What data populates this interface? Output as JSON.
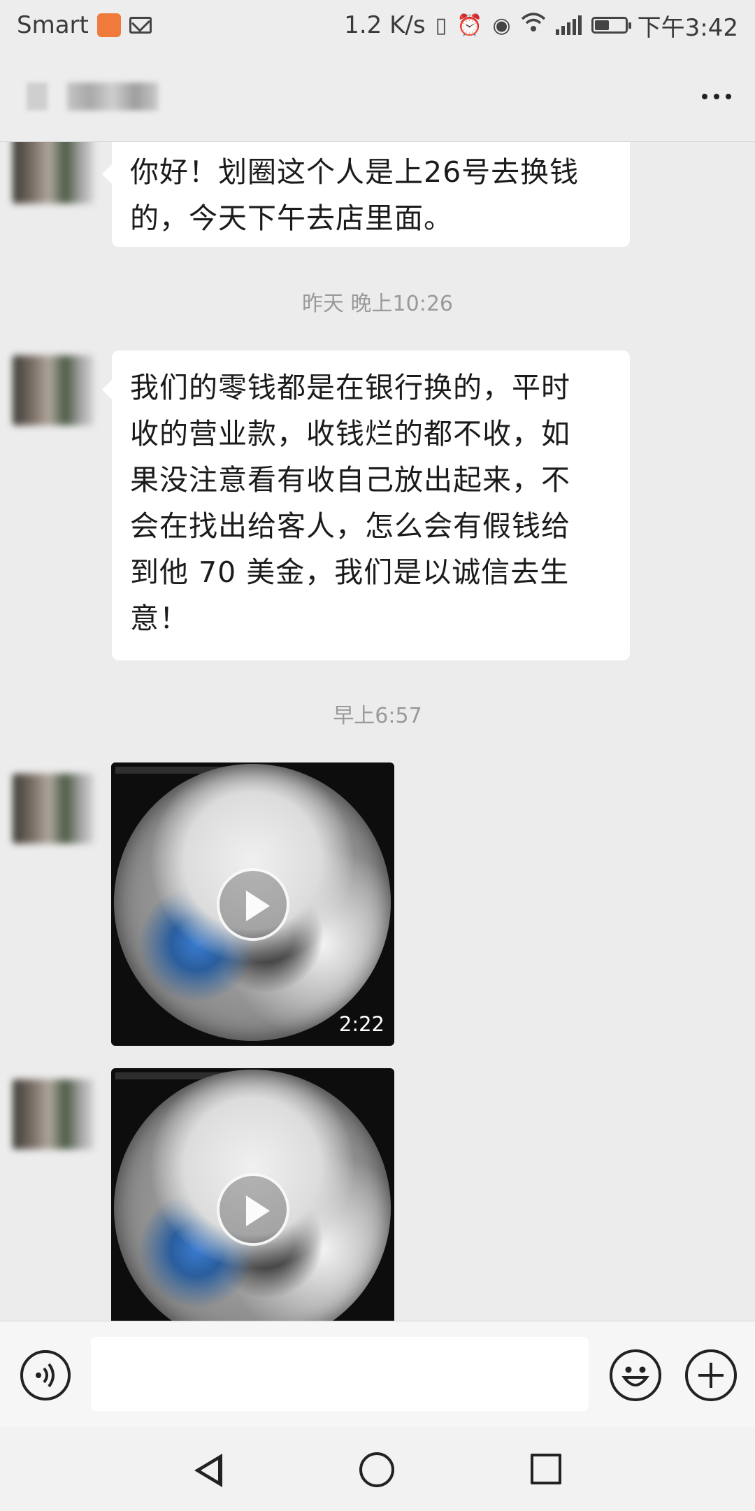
{
  "status_bar": {
    "carrier": "Smart",
    "net_speed": "1.2 K/s",
    "time": "下午3:42",
    "icons": [
      "app-badge-icon",
      "mail-icon",
      "vibrate-icon",
      "alarm-icon",
      "eye-icon",
      "wifi-icon",
      "signal-icon",
      "battery-icon"
    ],
    "battery_level": 0.45
  },
  "header": {
    "more_icon": "more-dots-icon"
  },
  "messages": [
    {
      "type": "text",
      "text_lines": [
        "你好！划圈这个人是上26号去换钱",
        "的，今天下午去店里面。"
      ]
    },
    {
      "type": "timestamp",
      "text": "昨天 晚上10:26"
    },
    {
      "type": "text",
      "text_lines": [
        "我们的零钱都是在银行换的，平时",
        "收的营业款，收钱烂的都不收，如",
        "果没注意看有收自己放出起来，不",
        "会在找出给客人，怎么会有假钱给",
        "到他 70 美金，我们是以诚信去生",
        "意！"
      ]
    },
    {
      "type": "timestamp",
      "text": "早上6:57"
    },
    {
      "type": "video",
      "duration": "2:22"
    },
    {
      "type": "video",
      "duration": ""
    }
  ],
  "input_bar": {
    "voice_icon": "voice-icon",
    "text_value": "",
    "emoji_icon": "emoji-icon",
    "plus_icon": "plus-icon"
  },
  "system_nav": {
    "icons": [
      "back-icon",
      "home-icon",
      "recent-apps-icon"
    ]
  }
}
